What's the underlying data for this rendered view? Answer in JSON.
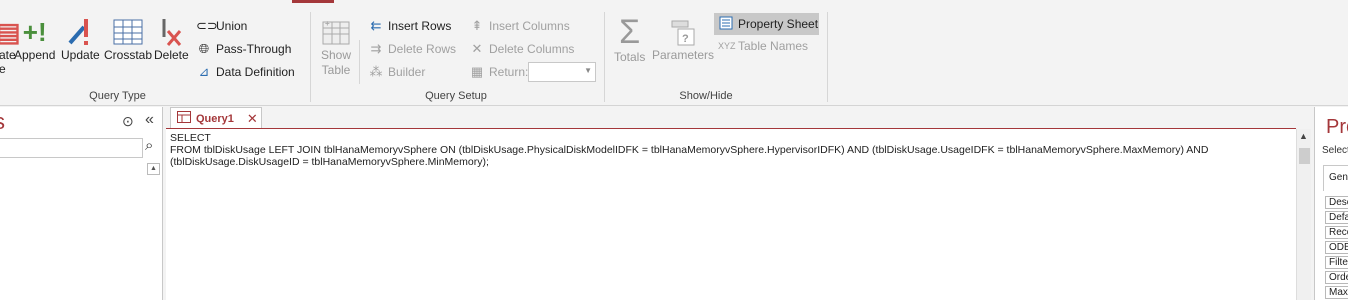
{
  "ribbon": {
    "query_type": {
      "label": "Query Type",
      "buttons": [
        {
          "label": "ate\ne",
          "icon": "make-table-icon"
        },
        {
          "label": "Append",
          "icon": "append-icon"
        },
        {
          "label": "Update",
          "icon": "update-icon"
        },
        {
          "label": "Crosstab",
          "icon": "crosstab-icon"
        },
        {
          "label": "Delete",
          "icon": "delete-icon"
        }
      ],
      "small_buttons": [
        {
          "label": "Union",
          "icon": "union-icon"
        },
        {
          "label": "Pass-Through",
          "icon": "globe-icon"
        },
        {
          "label": "Data Definition",
          "icon": "data-definition-icon"
        }
      ]
    },
    "query_setup": {
      "label": "Query Setup",
      "show_table": "Show\nTable",
      "insert_rows": "Insert Rows",
      "delete_rows": "Delete Rows",
      "builder": "Builder",
      "insert_columns": "Insert Columns",
      "delete_columns": "Delete Columns",
      "return_label": "Return:",
      "return_value": ""
    },
    "show_hide": {
      "label": "Show/Hide",
      "totals": "Totals",
      "parameters": "Parameters",
      "property_sheet": "Property Sheet",
      "table_names": "Table Names"
    }
  },
  "nav": {
    "title": "s"
  },
  "document": {
    "tab_label": "Query1",
    "sql_lines": [
      "SELECT",
      "FROM tblDiskUsage LEFT JOIN tblHanaMemoryvSphere ON (tblDiskUsage.PhysicalDiskModelIDFK = tblHanaMemoryvSphere.HypervisorIDFK) AND (tblDiskUsage.UsageIDFK = tblHanaMemoryvSphere.MaxMemory) AND",
      "(tblDiskUsage.DiskUsageID = tblHanaMemoryvSphere.MinMemory);"
    ]
  },
  "property_pane": {
    "title": "Pro",
    "subtitle": "Select",
    "tab": "Gene",
    "rows": [
      "Desc",
      "Defa",
      "Reco",
      "ODB",
      "Filter",
      "Orde",
      "Max"
    ]
  },
  "colors": {
    "accent": "#a4373a",
    "ribbon_bg": "#f3f3f3"
  }
}
